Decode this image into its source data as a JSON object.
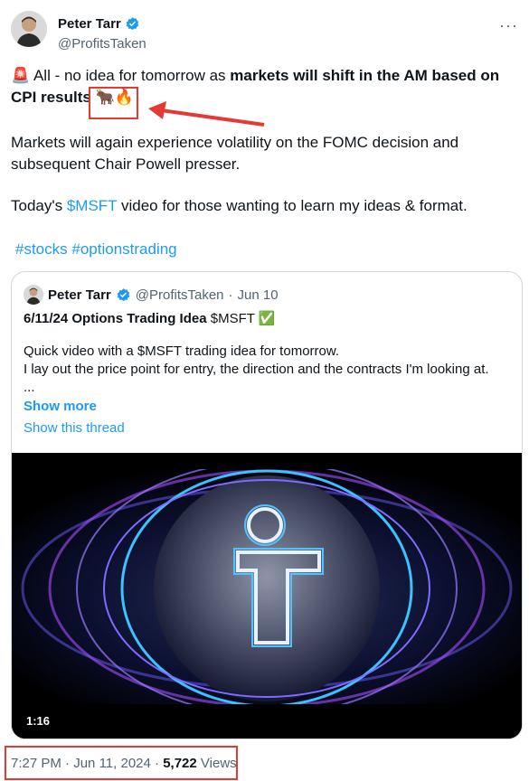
{
  "author": {
    "name": "Peter Tarr",
    "handle": "@ProfitsTaken"
  },
  "tweet": {
    "siren_emoji": "🚨",
    "text_intro": " All - no idea for tomorrow as ",
    "text_bold": "markets will shift in the AM based on CPI results",
    "emojis": "🐂🔥",
    "paragraph2": "Markets will again experience volatility on the FOMC decision and subsequent Chair Powell presser.",
    "paragraph3_prefix": "Today's ",
    "paragraph3_link": "$MSFT",
    "paragraph3_suffix": " video for those wanting to learn my ideas & format.",
    "hashtag1": "#stocks",
    "hashtag2": "#optionstrading"
  },
  "quoted": {
    "name": "Peter Tarr",
    "handle": "@ProfitsTaken",
    "dot": "·",
    "date": "Jun 10",
    "title_bold": "6/11/24 Options Trading Idea",
    "title_rest": " $MSFT ",
    "check_emoji": "✅",
    "body_line1": "Quick video with a $MSFT trading idea for tomorrow.",
    "body_line2": "I lay out the price point for entry, the direction and the contracts I'm looking at.",
    "body_line3": "...",
    "show_more": "Show more",
    "show_thread": "Show this thread",
    "video_duration": "1:16"
  },
  "meta": {
    "time": "7:27 PM",
    "sep": " · ",
    "date": "Jun 11, 2024",
    "sep2": " · ",
    "views_count": "5,722",
    "views_label": " Views"
  },
  "colors": {
    "accent": "#1d9bf0",
    "annotation": "#e53935"
  }
}
